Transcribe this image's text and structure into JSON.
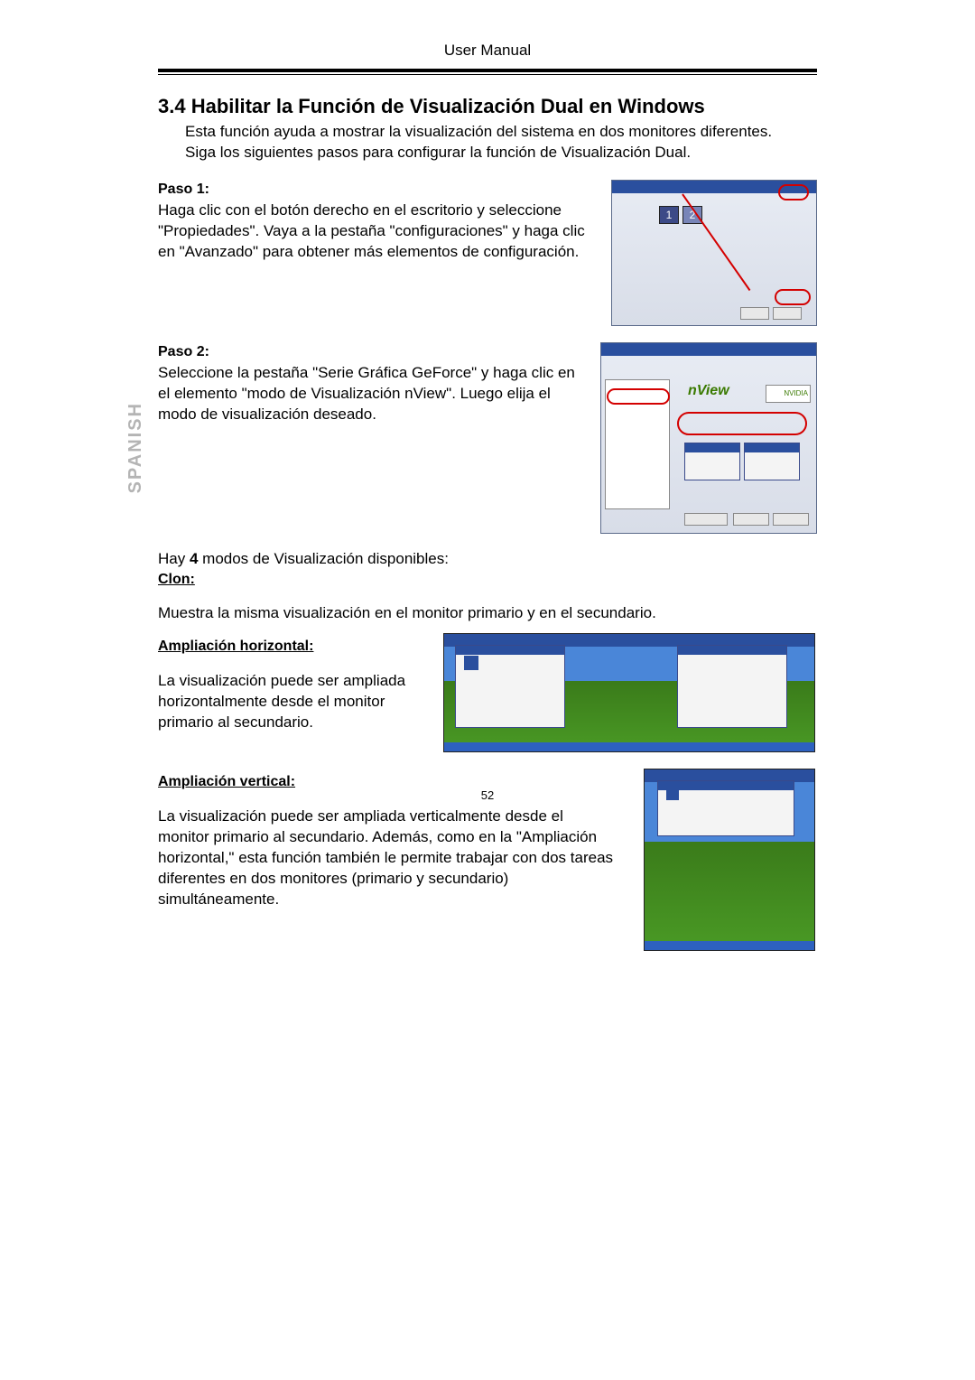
{
  "header": {
    "title": "User Manual"
  },
  "page_number": "52",
  "side_tab": "SPANISH",
  "section": {
    "heading": "3.4 Habilitar la Función de Visualización Dual en Windows",
    "intro": "Esta función ayuda a mostrar la visualización del sistema en dos monitores diferentes. Siga los siguientes pasos para configurar la función de Visualización Dual."
  },
  "steps": [
    {
      "label": "Paso 1:",
      "body": "Haga clic con el botón derecho en el escritorio y seleccione \"Propiedades\". Vaya a la pestaña \"configuraciones\" y haga clic en \"Avanzado\" para obtener más elementos de configuración."
    },
    {
      "label": "Paso 2:",
      "body": "Seleccione la pestaña \"Serie Gráfica GeForce\" y haga clic en el elemento \"modo de Visualización nView\". Luego elija el modo de visualización deseado."
    }
  ],
  "modes_intro_prefix": "Hay ",
  "modes_intro_count": "4",
  "modes_intro_suffix": " modos de Visualización disponibles:",
  "modes": [
    {
      "head": "Clon:",
      "body": "Muestra la misma visualización en el monitor primario y en el secundario."
    },
    {
      "head": "Ampliación horizontal:",
      "body": "La visualización puede ser ampliada horizontalmente desde el monitor primario al secundario."
    },
    {
      "head": "Ampliación vertical:",
      "body": "La visualización puede ser ampliada verticalmente desde el monitor primario al secundario. Además, como en la \"Ampliación horizontal,\" esta función también le permite trabajar con dos tareas diferentes en dos monitores (primario y secundario) simultáneamente."
    }
  ],
  "fig2_logo": "NVIDIA",
  "fig2_brand": "nView"
}
